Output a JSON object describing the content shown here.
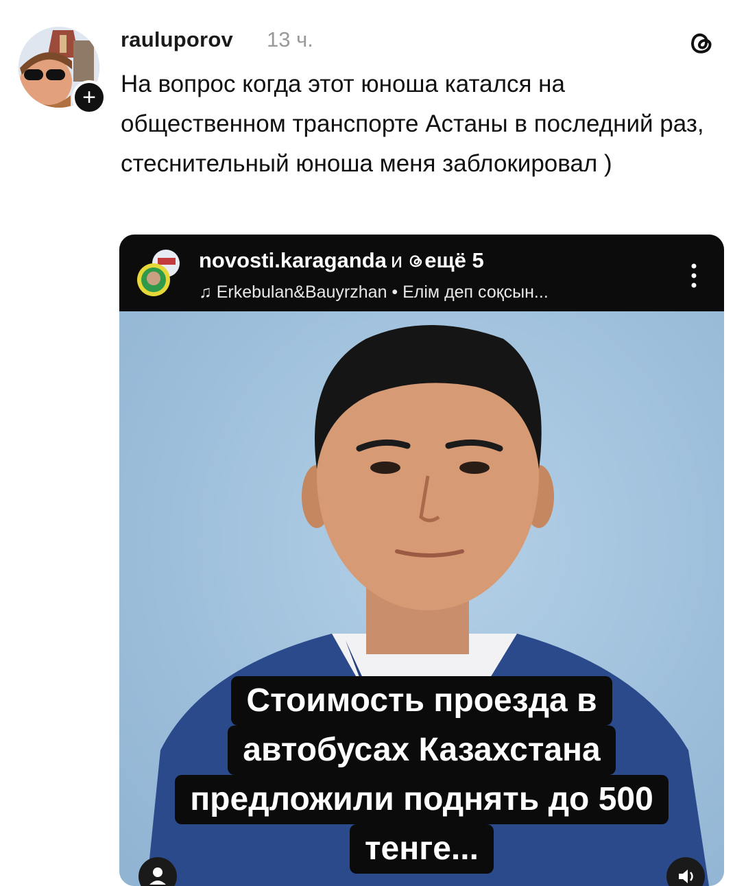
{
  "post": {
    "username": "rauluporov",
    "timestamp": "13 ч.",
    "text": "На вопрос когда этот юноша катался на общественном транспорте Астаны в последний раз, стеснительный юноша меня заблокировал )",
    "follow_label": "+"
  },
  "embed": {
    "account": "novosti.karaganda",
    "and_word": "и",
    "others": "ещё 5",
    "music_icon": "♫",
    "music": "Erkebulan&Bauyrzhan • Елім деп соқсын...",
    "caption_lines": [
      "Стоимость проезда в",
      "автобусах Казахстана",
      "предложили поднять до 500",
      "тенге..."
    ]
  },
  "icons": {
    "threads": "threads-logo-icon",
    "more": "more-vertical-icon",
    "music": "music-note-icon",
    "user_tag": "user-tag-icon",
    "sound": "sound-icon"
  }
}
